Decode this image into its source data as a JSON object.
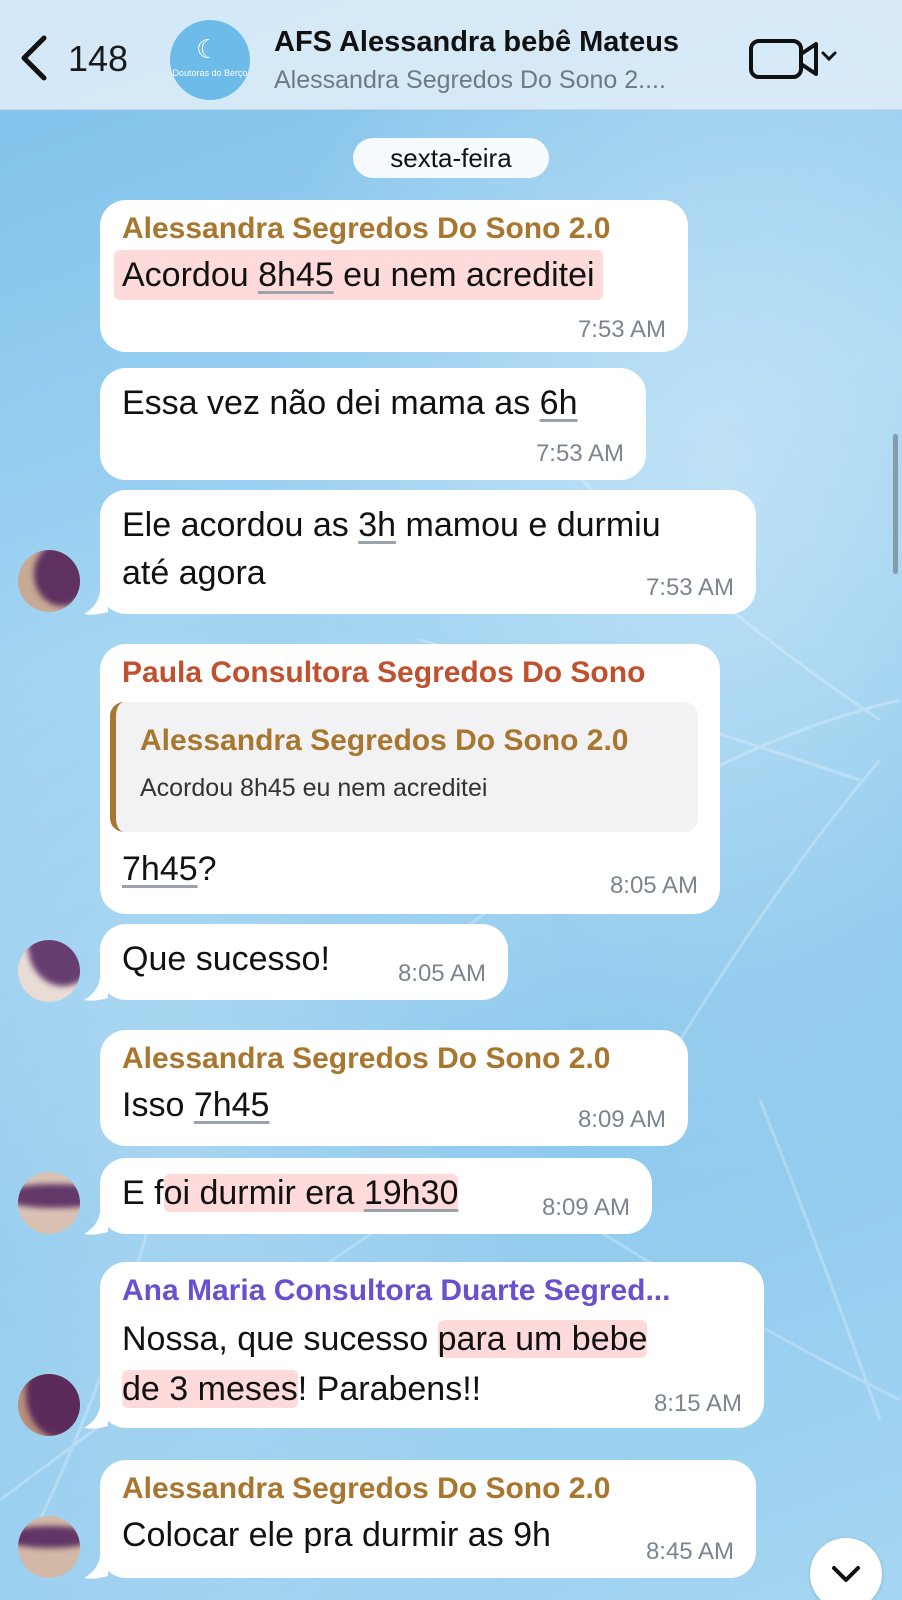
{
  "header": {
    "back_count": "148",
    "title": "AFS Alessandra bebê Mateus",
    "subtitle": "Alessandra Segredos Do Sono 2....",
    "group_avatar_text": "Doutoras do Berço"
  },
  "date_separator": "sexta-feira",
  "colors": {
    "alessandra": "#a8762e",
    "paula": "#c0502e",
    "ana_maria": "#6a4fcf"
  },
  "messages": [
    {
      "sender": "Alessandra Segredos Do Sono 2.0",
      "text_a": "Acordou ",
      "text_u": "8h45",
      "text_b": " eu nem acreditei",
      "time": "7:53 AM"
    },
    {
      "text_a": "Essa vez não dei mama as ",
      "text_u": "6h",
      "time": "7:53 AM"
    },
    {
      "text_a": "Ele acordou as ",
      "text_u": "3h",
      "text_b": " mamou e durmiu",
      "line2": "até agora",
      "time": "7:53 AM"
    },
    {
      "sender": "Paula Consultora Segredos Do Sono",
      "quote_sender": "Alessandra Segredos Do Sono 2.0",
      "quote_text": "Acordou 8h45 eu nem acreditei",
      "text_u": "7h45",
      "text_b": "?",
      "time": "8:05 AM"
    },
    {
      "text_a": "Que sucesso!",
      "time": "8:05 AM"
    },
    {
      "sender": "Alessandra Segredos Do Sono 2.0",
      "text_a": "Isso ",
      "text_u": "7h45",
      "time": "8:09 AM"
    },
    {
      "text_a": "E f",
      "text_h": "oi durmir era ",
      "text_u": "19h30",
      "time": "8:09 AM"
    },
    {
      "sender": "Ana Maria Consultora Duarte Segred...",
      "text_a": "Nossa, que sucesso ",
      "text_h": "para um bebe",
      "line2_h": "de 3 meses",
      "line2_b": "! Parabens!!",
      "time": "8:15 AM"
    },
    {
      "sender": "Alessandra Segredos Do Sono 2.0",
      "text_a": "Colocar ele pra durmir as 9h",
      "time": "8:45 AM"
    }
  ]
}
